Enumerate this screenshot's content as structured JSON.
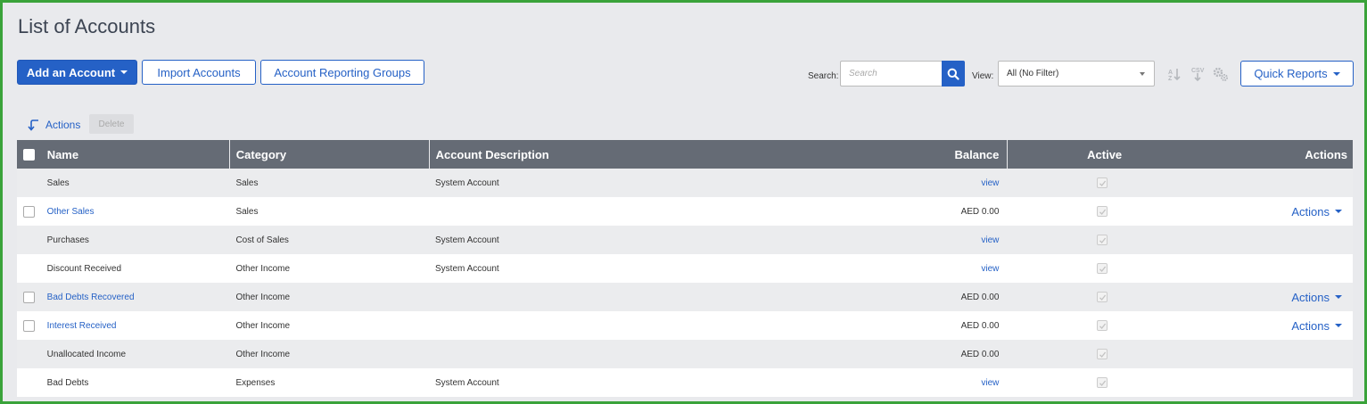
{
  "page": {
    "title": "List of Accounts"
  },
  "toolbar": {
    "add_account_label": "Add an Account",
    "import_accounts_label": "Import Accounts",
    "reporting_groups_label": "Account Reporting Groups",
    "search_label": "Search:",
    "search_placeholder": "Search",
    "view_label": "View:",
    "view_selected": "All (No Filter)",
    "quick_reports_label": "Quick Reports",
    "icons": [
      "sort-icon",
      "csv-export-icon",
      "settings-icon"
    ]
  },
  "bulk_bar": {
    "actions_label": "Actions",
    "delete_label": "Delete"
  },
  "table": {
    "headers": {
      "name": "Name",
      "category": "Category",
      "description": "Account Description",
      "balance": "Balance",
      "active": "Active",
      "actions": "Actions"
    },
    "rows": [
      {
        "name": "Sales",
        "category": "Sales",
        "description": "System Account",
        "balance": "view",
        "active": true,
        "actions": ""
      },
      {
        "name": "Other Sales",
        "category": "Sales",
        "description": "",
        "balance": "AED 0.00",
        "active": true,
        "actions": "Actions"
      },
      {
        "name": "Purchases",
        "category": "Cost of Sales",
        "description": "System Account",
        "balance": "view",
        "active": true,
        "actions": ""
      },
      {
        "name": "Discount Received",
        "category": "Other Income",
        "description": "System Account",
        "balance": "view",
        "active": true,
        "actions": ""
      },
      {
        "name": "Bad Debts Recovered",
        "category": "Other Income",
        "description": "",
        "balance": "AED 0.00",
        "active": true,
        "actions": "Actions"
      },
      {
        "name": "Interest Received",
        "category": "Other Income",
        "description": "",
        "balance": "AED 0.00",
        "active": true,
        "actions": "Actions"
      },
      {
        "name": "Unallocated Income",
        "category": "Other Income",
        "description": "",
        "balance": "AED 0.00",
        "active": true,
        "actions": ""
      },
      {
        "name": "Bad Debts",
        "category": "Expenses",
        "description": "System Account",
        "balance": "view",
        "active": true,
        "actions": ""
      }
    ]
  },
  "colors": {
    "primary": "#2561c6",
    "header_bg": "#656b75",
    "page_bg": "#e9eaed",
    "frame": "#3aa33a"
  }
}
